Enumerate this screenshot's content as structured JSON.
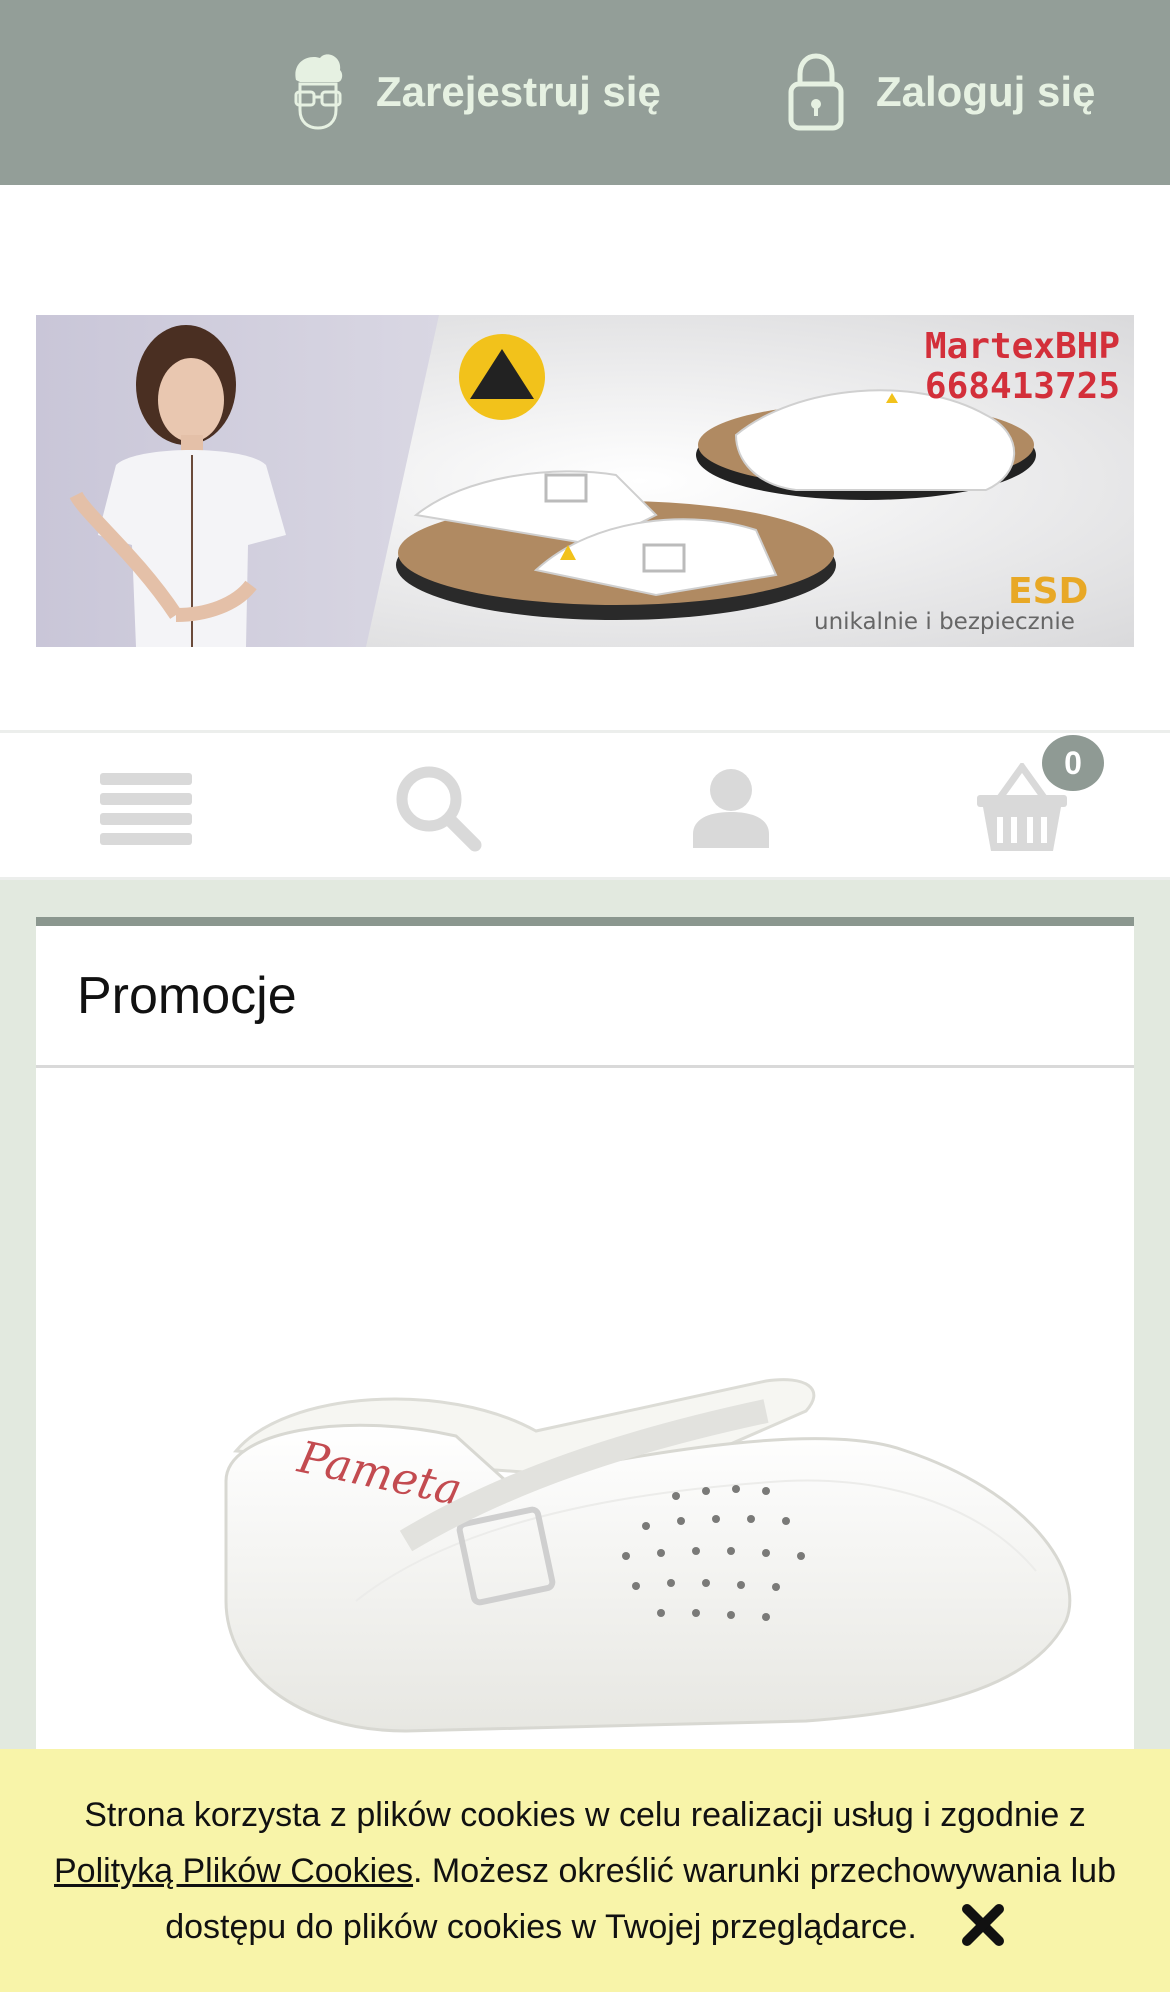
{
  "topbar": {
    "register_label": "Zarejestruj się",
    "login_label": "Zaloguj się",
    "background": "#939e98",
    "text_color": "#e6f1e2"
  },
  "banner": {
    "brand": "MartexBHP",
    "phone": "668413725",
    "badge": "ESD",
    "tagline": "unikalnie i bezpiecznie"
  },
  "iconnav": {
    "items": [
      {
        "name": "menu-icon"
      },
      {
        "name": "search-icon"
      },
      {
        "name": "user-icon"
      },
      {
        "name": "cart-icon"
      }
    ],
    "cart_count": "0"
  },
  "promo": {
    "title": "Promocje",
    "accent": "#8b978f",
    "product_brand": "Pameta"
  },
  "cookie": {
    "text_before": "Strona korzysta z plików cookies w celu realizacji usług i zgodnie z ",
    "link": "Polityką Plików Cookies",
    "text_after": ". Możesz określić warunki przechowywania lub dostępu do plików cookies w Twojej przeglądarce.",
    "background": "#f8f4a9"
  }
}
